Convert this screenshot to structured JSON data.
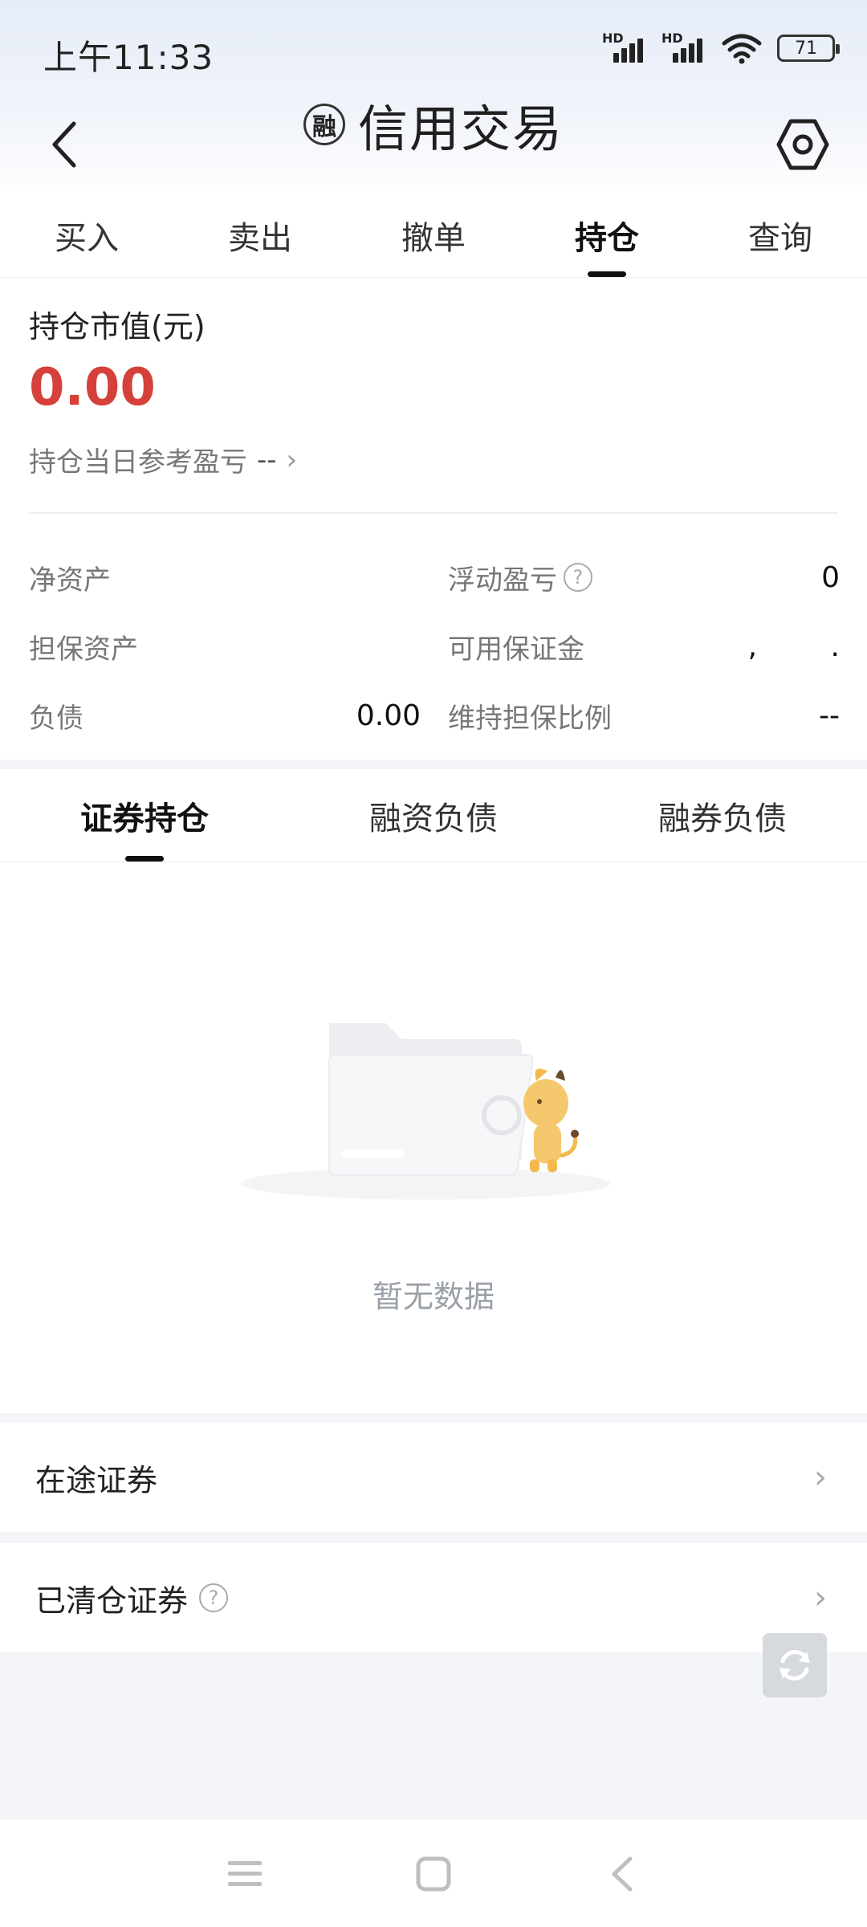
{
  "status_bar": {
    "time": "上午11:33",
    "signal1_hd": "HD",
    "signal2_hd": "HD",
    "battery": "71"
  },
  "header": {
    "badge": "融",
    "title": "信用交易"
  },
  "main_tabs": [
    {
      "label": "买入"
    },
    {
      "label": "卖出"
    },
    {
      "label": "撤单"
    },
    {
      "label": "持仓",
      "active": true
    },
    {
      "label": "查询"
    }
  ],
  "summary": {
    "market_value_label": "持仓市值(元)",
    "market_value": "0.00",
    "daily_pnl_label": "持仓当日参考盈亏",
    "daily_pnl_value": "--"
  },
  "metrics": [
    {
      "left_label": "净资产",
      "left_value": "",
      "right_label": "浮动盈亏",
      "right_value": "0",
      "right_help": true
    },
    {
      "left_label": "担保资产",
      "left_value": "",
      "right_label": "可用保证金",
      "right_value": ",        ."
    },
    {
      "left_label": "负债",
      "left_value": "0.00",
      "right_label": "维持担保比例",
      "right_value": "--"
    }
  ],
  "sub_tabs": [
    {
      "label": "证券持仓",
      "active": true
    },
    {
      "label": "融资负债"
    },
    {
      "label": "融券负债"
    }
  ],
  "empty_state": {
    "text": "暂无数据"
  },
  "list": {
    "in_transit": "在途证券",
    "cleared": "已清仓证券"
  },
  "colors": {
    "accent_red": "#d6403a",
    "text_primary": "#222222",
    "text_secondary": "#777777"
  }
}
